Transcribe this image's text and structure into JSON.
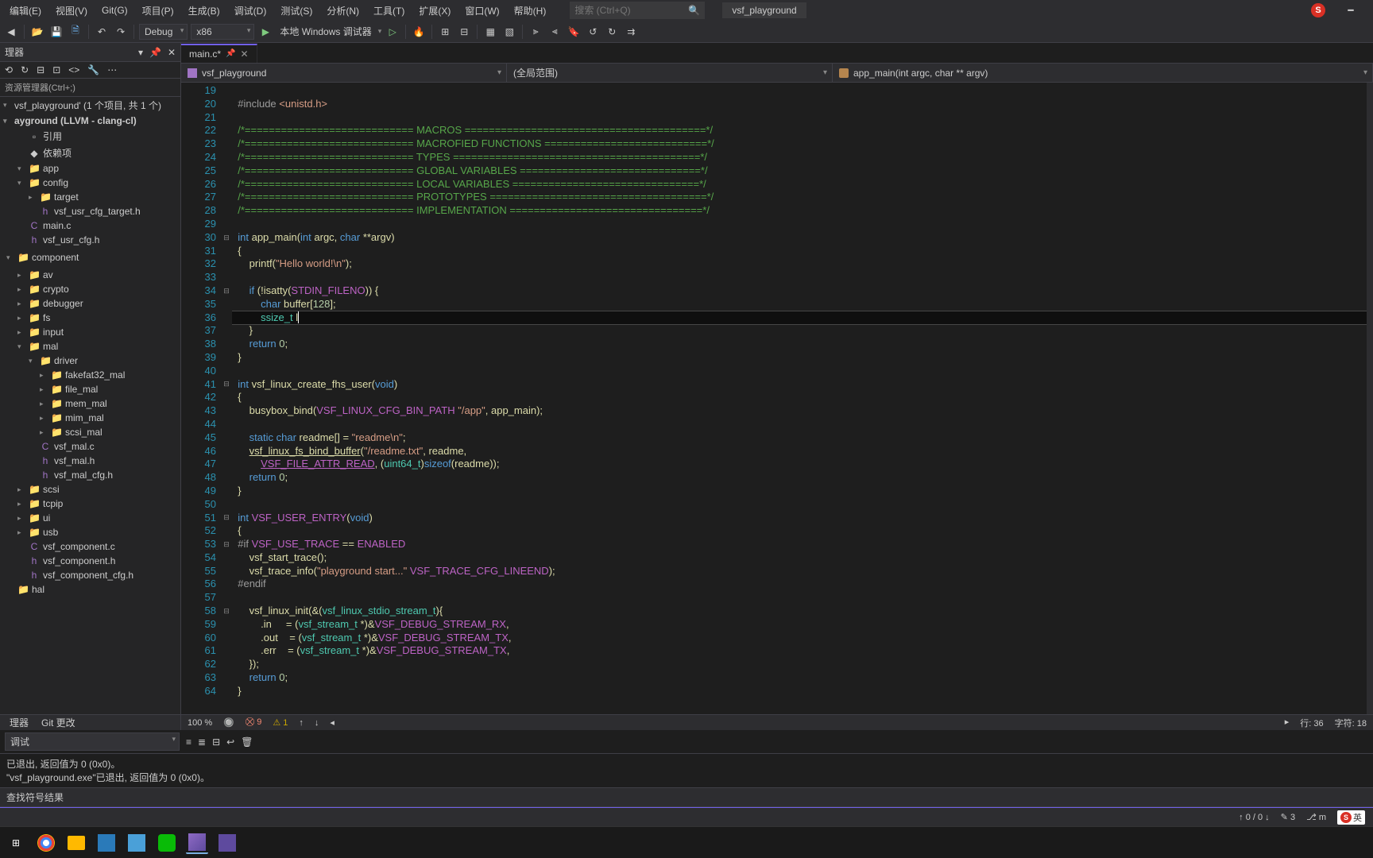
{
  "menubar": {
    "items": [
      "编辑(E)",
      "视图(V)",
      "Git(G)",
      "项目(P)",
      "生成(B)",
      "调试(D)",
      "测试(S)",
      "分析(N)",
      "工具(T)",
      "扩展(X)",
      "窗口(W)",
      "帮助(H)"
    ],
    "search_placeholder": "搜索 (Ctrl+Q)",
    "project_name": "vsf_playground",
    "sogou": "S"
  },
  "toolbar": {
    "config": "Debug",
    "platform": "x86",
    "debugger": "本地 Windows 调试器"
  },
  "sidebar": {
    "title": "理器",
    "breadcrumb": "资源管理器(Ctrl+;)",
    "solution": "vsf_playground' (1 个项目, 共 1 个)",
    "project": "ayground (LLVM - clang-cl)",
    "tree": [
      {
        "label": "引用",
        "depth": 1,
        "icon": "ref"
      },
      {
        "label": "依赖项",
        "depth": 1,
        "icon": "dep"
      },
      {
        "label": "app",
        "depth": 1,
        "icon": "folder",
        "exp": "▾"
      },
      {
        "label": "config",
        "depth": 1,
        "icon": "folder",
        "exp": "▾"
      },
      {
        "label": "target",
        "depth": 2,
        "icon": "folder",
        "exp": "▸"
      },
      {
        "label": "vsf_usr_cfg_target.h",
        "depth": 2,
        "icon": "h"
      },
      {
        "label": "main.c",
        "depth": 1,
        "icon": "c"
      },
      {
        "label": "vsf_usr_cfg.h",
        "depth": 1,
        "icon": "h"
      },
      {
        "label": "",
        "depth": 0
      },
      {
        "label": "component",
        "depth": 0,
        "icon": "folder",
        "exp": "▾"
      },
      {
        "label": "",
        "depth": 0
      },
      {
        "label": "av",
        "depth": 1,
        "icon": "folder",
        "exp": "▸"
      },
      {
        "label": "crypto",
        "depth": 1,
        "icon": "folder",
        "exp": "▸"
      },
      {
        "label": "debugger",
        "depth": 1,
        "icon": "folder",
        "exp": "▸"
      },
      {
        "label": "fs",
        "depth": 1,
        "icon": "folder",
        "exp": "▸"
      },
      {
        "label": "input",
        "depth": 1,
        "icon": "folder",
        "exp": "▸"
      },
      {
        "label": "mal",
        "depth": 1,
        "icon": "folder",
        "exp": "▾"
      },
      {
        "label": "driver",
        "depth": 2,
        "icon": "folder",
        "exp": "▾"
      },
      {
        "label": "fakefat32_mal",
        "depth": 3,
        "icon": "folder",
        "exp": "▸"
      },
      {
        "label": "file_mal",
        "depth": 3,
        "icon": "folder",
        "exp": "▸"
      },
      {
        "label": "mem_mal",
        "depth": 3,
        "icon": "folder",
        "exp": "▸"
      },
      {
        "label": "mim_mal",
        "depth": 3,
        "icon": "folder",
        "exp": "▸"
      },
      {
        "label": "scsi_mal",
        "depth": 3,
        "icon": "folder",
        "exp": "▸"
      },
      {
        "label": "vsf_mal.c",
        "depth": 2,
        "icon": "c"
      },
      {
        "label": "vsf_mal.h",
        "depth": 2,
        "icon": "h"
      },
      {
        "label": "vsf_mal_cfg.h",
        "depth": 2,
        "icon": "h"
      },
      {
        "label": "scsi",
        "depth": 1,
        "icon": "folder",
        "exp": "▸"
      },
      {
        "label": "tcpip",
        "depth": 1,
        "icon": "folder",
        "exp": "▸"
      },
      {
        "label": "ui",
        "depth": 1,
        "icon": "folder",
        "exp": "▸"
      },
      {
        "label": "usb",
        "depth": 1,
        "icon": "folder",
        "exp": "▸"
      },
      {
        "label": "vsf_component.c",
        "depth": 1,
        "icon": "c"
      },
      {
        "label": "vsf_component.h",
        "depth": 1,
        "icon": "h"
      },
      {
        "label": "vsf_component_cfg.h",
        "depth": 1,
        "icon": "h"
      },
      {
        "label": "hal",
        "depth": 0,
        "icon": "folder"
      }
    ],
    "bottom_tabs": [
      "理器",
      "Git 更改"
    ]
  },
  "editor": {
    "tab_name": "main.c*",
    "nav_project": "vsf_playground",
    "nav_scope": "(全局范围)",
    "nav_func": "app_main(int argc, char ** argv)",
    "line_start": 19,
    "line_end": 64,
    "zoom": "100 %",
    "errors": "9",
    "warnings": "1",
    "cursor_line": "行: 36",
    "cursor_col": "字符: 18"
  },
  "output": {
    "dropdown": "调试",
    "lines": [
      "已退出, 返回值为 0 (0x0)。",
      "\"vsf_playground.exe\"已退出, 返回值为 0 (0x0)。"
    ]
  },
  "symbols": {
    "title": "查找符号结果"
  },
  "statusbar": {
    "arrows": "↑ 0 / 0 ↓",
    "changes": "3",
    "branch": "m",
    "ime": "英"
  }
}
